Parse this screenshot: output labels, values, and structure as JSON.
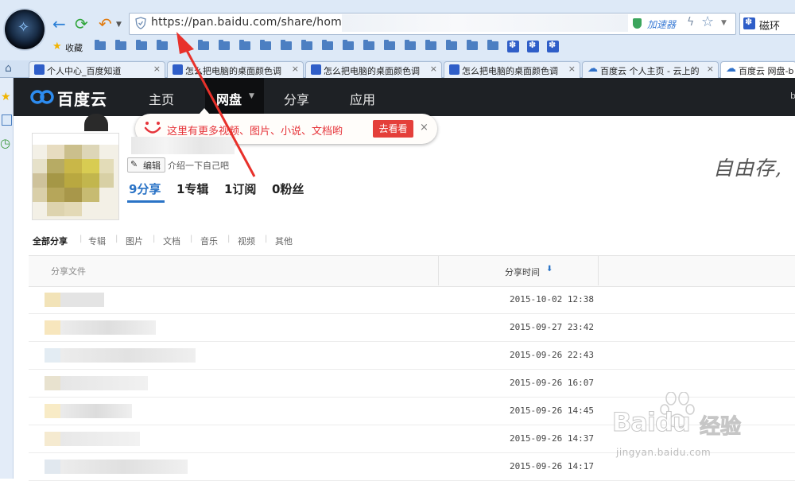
{
  "browser": {
    "url": "https://pan.baidu.com/share/home?u",
    "accelerator_label": "加速器",
    "search_value": "磁环",
    "favorites_label": "收藏"
  },
  "tabs": [
    {
      "label": "个人中心_百度知道",
      "icon": "paw-icon"
    },
    {
      "label": "怎么把电脑的桌面颜色调",
      "icon": "paw-icon"
    },
    {
      "label": "怎么把电脑的桌面颜色调",
      "icon": "paw-icon"
    },
    {
      "label": "怎么把电脑的桌面颜色调",
      "icon": "paw-icon"
    },
    {
      "label": "百度云 个人主页 - 云上的",
      "icon": "cloud-icon"
    },
    {
      "label": "百度云 网盘-b",
      "icon": "cloud-icon",
      "active": true
    }
  ],
  "site": {
    "logo_text": "百度云",
    "nav": [
      "主页",
      "网盘",
      "分享",
      "应用"
    ],
    "nav_right": "b"
  },
  "tooltip": {
    "text": "这里有更多视频、图片、小说、文档哟",
    "button": "去看看",
    "close": "×"
  },
  "profile": {
    "edit_label": "编辑",
    "intro": "介绍一下自己吧",
    "stats": [
      "9分享",
      "1专辑",
      "1订阅",
      "0粉丝"
    ],
    "slogan": "自由存,"
  },
  "filters": [
    "全部分享",
    "专辑",
    "图片",
    "文档",
    "音乐",
    "视频",
    "其他"
  ],
  "table": {
    "col_file": "分享文件",
    "col_time": "分享时间",
    "rows": [
      {
        "time": "2015-10-02 12:38"
      },
      {
        "time": "2015-09-27 23:42"
      },
      {
        "time": "2015-09-26 22:43"
      },
      {
        "time": "2015-09-26 16:07"
      },
      {
        "time": "2015-09-26 14:45"
      },
      {
        "time": "2015-09-26 14:37"
      },
      {
        "time": "2015-09-26 14:17"
      }
    ]
  },
  "watermark": {
    "brand": "Bai",
    "brand_tail": "du",
    "cn": "经验",
    "url": "jingyan.baidu.com"
  },
  "colors": {
    "nav_bg": "#1e2125",
    "accent_blue": "#2a73c6",
    "tip_red": "#e6343a",
    "arrow_red": "#e8312b"
  }
}
